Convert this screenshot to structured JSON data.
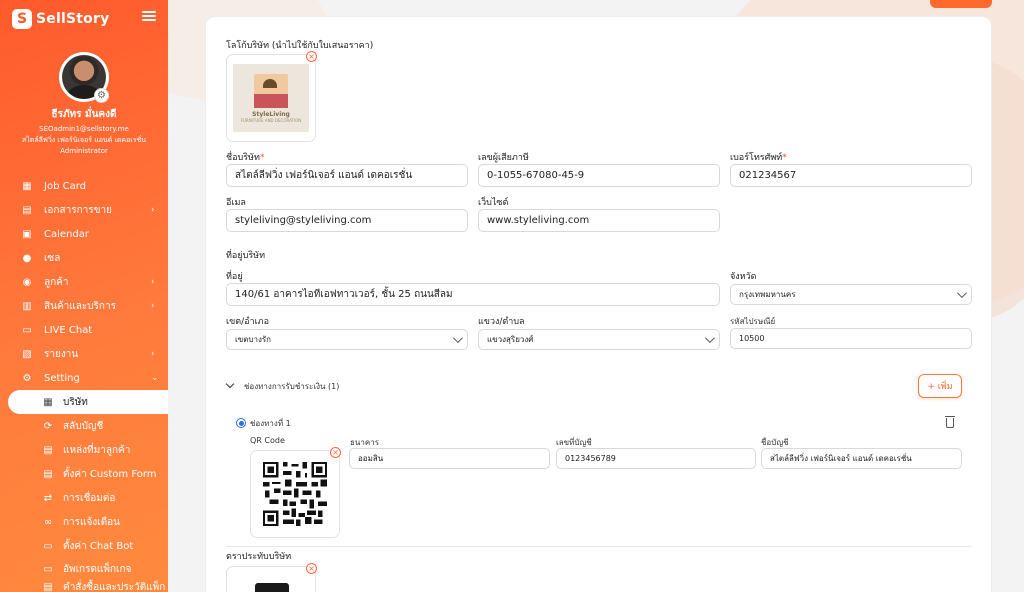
{
  "colors": {
    "brand": "#ff5a2c",
    "accent": "#ff6a2c",
    "radio": "#2b6fe0"
  },
  "sidebar": {
    "brand_initial": "S",
    "brand_name": "SellStory",
    "user": {
      "name": "ธีรภัทร มั่นคงดี",
      "email": "SEOadmin1@sellstory.me",
      "company": "สไตล์ลีฟวิ่ง เฟอร์นิเจอร์ แอนด์ เดคอเรชั่น",
      "role": "Administrator"
    },
    "items": [
      {
        "label": "Job Card",
        "icon": "clipboard-icon"
      },
      {
        "label": "เอกสารการขาย",
        "icon": "document-icon",
        "has_children": true
      },
      {
        "label": "Calendar",
        "icon": "calendar-icon"
      },
      {
        "label": "เซล",
        "icon": "person-icon"
      },
      {
        "label": "ลูกค้า",
        "icon": "user-icon",
        "has_children": true
      },
      {
        "label": "สินค้าและบริการ",
        "icon": "box-icon",
        "has_children": true
      },
      {
        "label": "LIVE Chat",
        "icon": "chat-icon"
      },
      {
        "label": "รายงาน",
        "icon": "report-icon",
        "has_children": true
      },
      {
        "label": "Setting",
        "icon": "gear-icon",
        "expanded": true
      }
    ],
    "sub_items": [
      {
        "label": "บริษัท",
        "icon": "building-icon",
        "active": true
      },
      {
        "label": "สลับบัญชี",
        "icon": "switch-icon"
      },
      {
        "label": "แหล่งที่มาลูกค้า",
        "icon": "source-icon"
      },
      {
        "label": "ตั้งค่า Custom Form",
        "icon": "form-icon"
      },
      {
        "label": "การเชื่อมต่อ",
        "icon": "arrows-icon"
      },
      {
        "label": "การแจ้งเตือน",
        "icon": "link-icon"
      },
      {
        "label": "ตั้งค่า Chat Bot",
        "icon": "bot-icon"
      },
      {
        "label": "อัพเกรดแพ็กเกจ",
        "icon": "monitor-icon"
      },
      {
        "label": "คำสั่งซื้อและประวัติแพ็ก",
        "icon": "history-icon"
      }
    ]
  },
  "form": {
    "logo_label": "โลโก้บริษัท (นำไปใช้กับใบเสนอราคา)",
    "logo_text": "StyleLiving",
    "logo_subtext": "FURNITURE AND DECORATION",
    "company_name": {
      "label": "ชื่อบริษัท",
      "required": "*",
      "value": "สไตล์ลีฟวิ่ง เฟอร์นิเจอร์ แอนด์ เดคอเรชั่น"
    },
    "tax_id": {
      "label": "เลขผู้เสียภาษี",
      "value": "0-1055-67080-45-9"
    },
    "phone": {
      "label": "เบอร์โทรศัพท์",
      "required": "*",
      "value": "021234567"
    },
    "email": {
      "label": "อีเมล",
      "value": "styleliving@styleliving.com"
    },
    "website": {
      "label": "เว็บไซต์",
      "value": "www.styleliving.com"
    },
    "address_section": "ที่อยู่บริษัท",
    "address": {
      "label": "ที่อยู่",
      "value": "140/61 อาคารไอทีเอฟทาวเวอร์, ชั้น 25 ถนนสีลม"
    },
    "province": {
      "label": "จังหวัด",
      "value": "กรุงเทพมหานคร"
    },
    "district": {
      "label": "เขต/อำเภอ",
      "value": "เขตบางรัก"
    },
    "subdistrict": {
      "label": "แขวง/ตำบล",
      "value": "แขวงสุริยวงศ์"
    },
    "postal": {
      "label": "รหัสไปรษณีย์",
      "value": "10500"
    },
    "payment_section": "ช่องทางการรับชำระเงิน (1)",
    "add_label": "+ เพิ่ม",
    "payment": {
      "channel_label": "ช่องทางที่ 1",
      "qr_label": "QR Code",
      "bank_label": "ธนาคาร",
      "bank_value": "ออมสิน",
      "account_no_label": "เลขที่บัญชี",
      "account_no_value": "0123456789",
      "account_name_label": "ชื่อบัญชี",
      "account_name_value": "สไตล์ลีฟวิ่ง เฟอร์นิเจอร์ แอนด์ เดคอเรชั่น"
    },
    "stamp_label": "ตราประทับบริษัท"
  }
}
